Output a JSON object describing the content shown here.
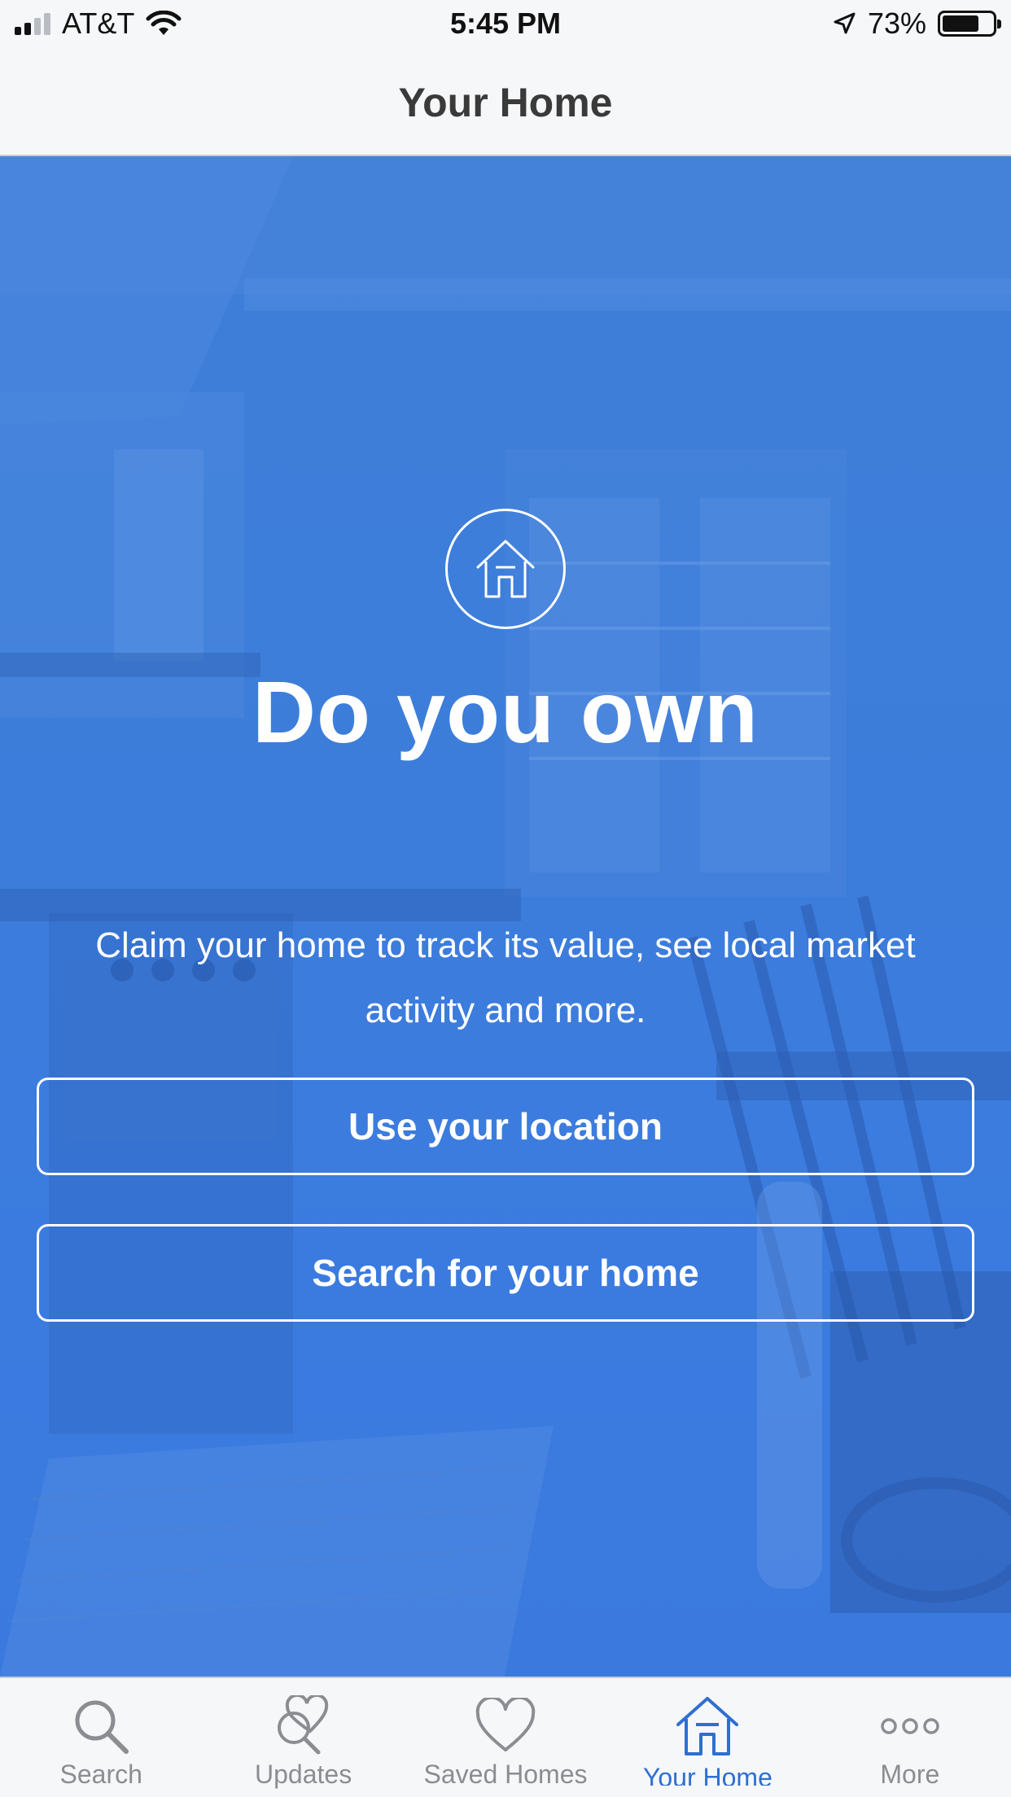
{
  "status_bar": {
    "carrier": "AT&T",
    "time": "5:45 PM",
    "battery_percent": "73%",
    "battery_level": 0.73,
    "icons": [
      "cellular-signal-icon",
      "wifi-icon",
      "location-arrow-icon",
      "battery-icon"
    ]
  },
  "header": {
    "title": "Your Home"
  },
  "hero": {
    "icon": "house-outline-icon",
    "headline": "Do you own",
    "description": "Claim your home to track its value, see local market activity and more.",
    "buttons": {
      "use_location": "Use your location",
      "search_home": "Search for your home"
    },
    "accent_color": "#3c7ddb"
  },
  "tab_bar": {
    "tabs": [
      {
        "label": "Search",
        "icon": "search-icon",
        "active": false
      },
      {
        "label": "Updates",
        "icon": "updates-heart-search-icon",
        "active": false
      },
      {
        "label": "Saved Homes",
        "icon": "heart-icon",
        "active": false
      },
      {
        "label": "Your Home",
        "icon": "house-icon",
        "active": true
      },
      {
        "label": "More",
        "icon": "more-dots-icon",
        "active": false
      }
    ],
    "active_color": "#2f6fcf",
    "inactive_color": "#8a8d91"
  }
}
